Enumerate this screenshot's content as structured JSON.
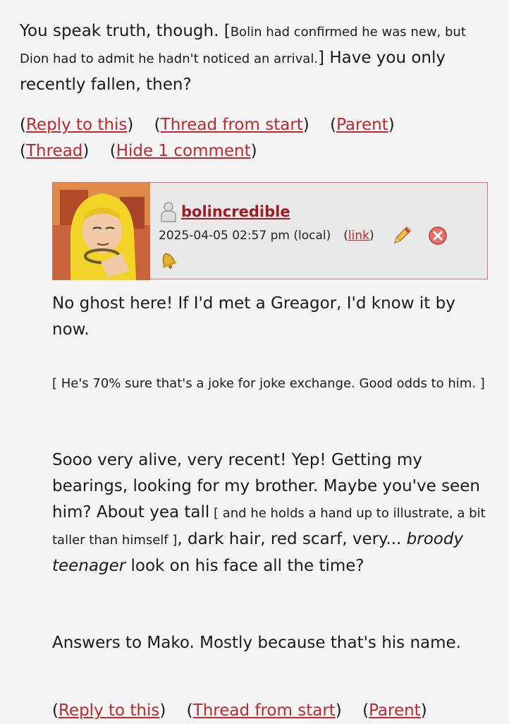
{
  "parent": {
    "text_a": "You speak truth, though. [",
    "text_b": "Bolin had confirmed he was new, but Dion had to admit he hadn't noticed an arrival.",
    "text_c": "] Have you only recently fallen, then?",
    "links": {
      "reply": "Reply to this",
      "thread_start": "Thread from start",
      "parent": "Parent",
      "thread": "Thread",
      "hide": "Hide 1 comment"
    }
  },
  "comment": {
    "username": "bolincredible",
    "timestamp": "2025-04-05 02:57 pm (local)",
    "link_label": "link",
    "p1": "No ghost here! If I'd met a Greagor, I'd know it by now.",
    "p2": "[ He's 70% sure that's a joke for joke exchange. Good odds to him. ]",
    "p3a": "Sooo very alive, very recent! Yep! Getting my bearings, looking for my brother. Maybe you've seen him? About yea tall",
    "p3b": " [ and he holds a hand up to illustrate, a bit taller than himself ]",
    "p3c": ", dark hair, red scarf, very... ",
    "p3d": "broody teenager",
    "p3e": " look on his face all the time?",
    "p4": "Answers to Mako. Mostly because that's his name.",
    "links": {
      "reply": "Reply to this",
      "thread_start": "Thread from start",
      "parent": "Parent"
    }
  },
  "icons": {
    "user": "user-icon",
    "edit": "pencil-icon",
    "delete": "delete-icon",
    "track": "bell-icon"
  }
}
